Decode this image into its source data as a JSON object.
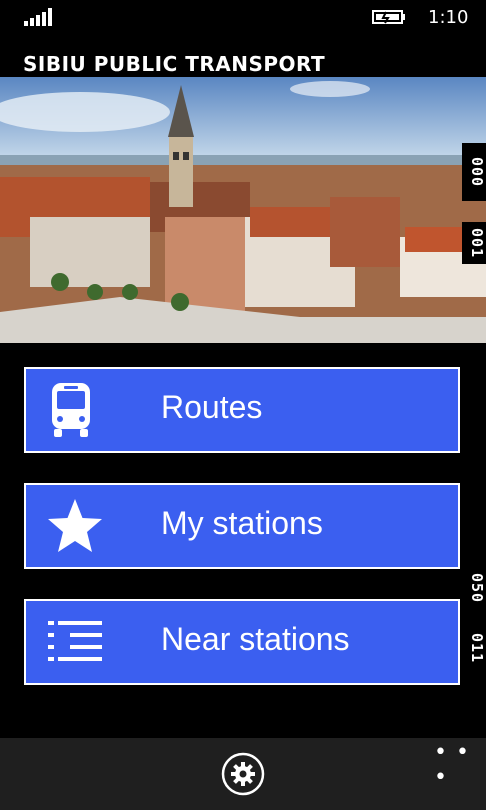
{
  "status_bar": {
    "time": "1:10"
  },
  "app": {
    "title": "SIBIU PUBLIC TRANSPORT"
  },
  "hero_image": {
    "description_icon": "city-photo"
  },
  "side_labels": [
    "000",
    "001",
    "050",
    "011"
  ],
  "menu": [
    {
      "label": "Routes",
      "icon": "bus-icon"
    },
    {
      "label": "My stations",
      "icon": "star-icon"
    },
    {
      "label": "Near stations",
      "icon": "list-icon"
    }
  ],
  "app_bar": {
    "more": "• • •",
    "settings_icon": "gear-icon"
  },
  "colors": {
    "tile": "#3b5ff0",
    "background": "#000000",
    "app_bar": "#1f1f1f"
  }
}
